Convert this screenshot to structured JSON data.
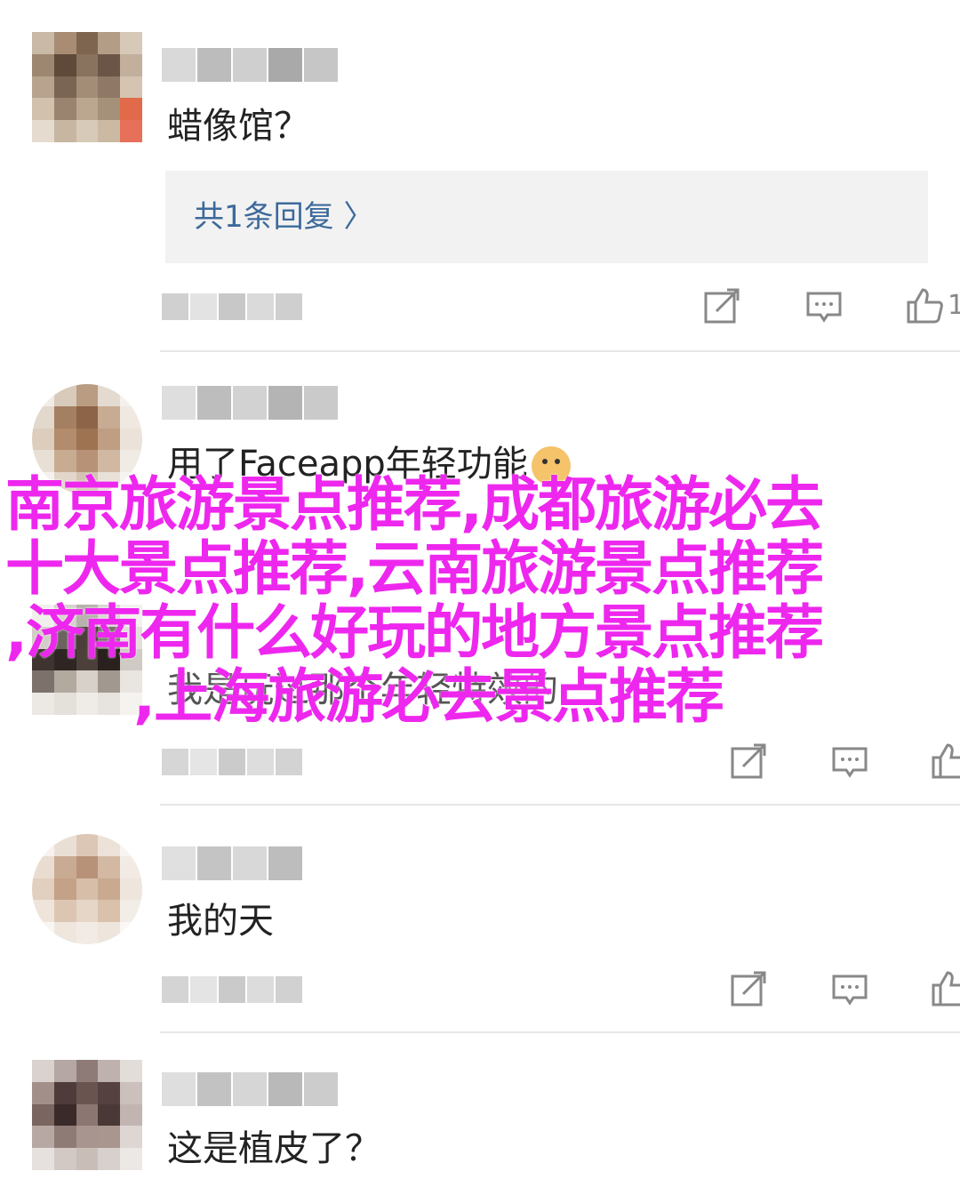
{
  "comments": [
    {
      "text": "蜡像馆？",
      "reply_label": "共1条回复 〉",
      "like_count": "1"
    },
    {
      "text": "用了Faceapp年轻功能",
      "emoji": "dog-face-emoji",
      "like_count": ""
    },
    {
      "text": "我是玩过那个年轻特效的",
      "like_count": ""
    },
    {
      "text": "我的天",
      "like_count": ""
    },
    {
      "text": "这是植皮了？",
      "like_count": ""
    }
  ],
  "icons": {
    "share": "share-icon",
    "reply": "comment-icon",
    "like": "thumbs-up-icon"
  },
  "overlay": {
    "line1": "南京旅游景点推荐,成都旅游必去",
    "line2": "十大景点推荐,云南旅游景点推荐",
    "line3": ",济南有什么好玩的地方景点推荐",
    "line4": ",上海旅游必去景点推荐"
  },
  "colors": {
    "overlay_text": "#ee27ee",
    "reply_link": "#3d6a9b",
    "reply_bg": "#f2f2f2",
    "icon_gray": "#888888"
  }
}
